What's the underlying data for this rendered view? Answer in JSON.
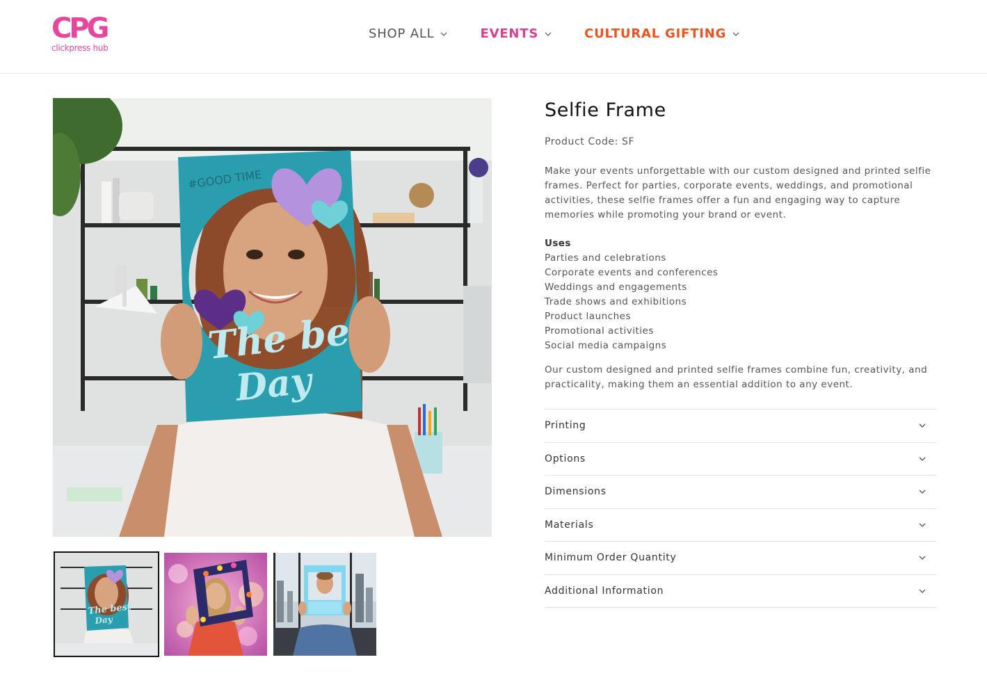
{
  "header": {
    "logo": {
      "mark": "CPG",
      "subtitle": "clickpress hub",
      "color": "#e8469e"
    },
    "nav": [
      {
        "label": "SHOP ALL",
        "color": "#555555",
        "icon": "chevron-down-icon"
      },
      {
        "label": "EVENTS",
        "color": "#e03c97",
        "icon": "chevron-down-icon"
      },
      {
        "label": "CULTURAL GIFTING",
        "color": "#f0521e",
        "icon": "chevron-down-icon"
      }
    ]
  },
  "gallery": {
    "main_image": {
      "frame_tag": "#GOOD TIME",
      "frame_text_line1": "The best",
      "frame_text_line2": "Day",
      "frame_color": "#2a9eaf"
    },
    "thumbnails": [
      {
        "selected": true,
        "frame_text_line1": "The best",
        "frame_text_line2": "Day"
      },
      {
        "selected": false
      },
      {
        "selected": false
      }
    ]
  },
  "product": {
    "title": "Selfie Frame",
    "code": "Product Code: SF",
    "description": "Make your events unforgettable with our custom designed and printed selfie frames. Perfect for parties, corporate events, weddings, and promotional activities, these selfie frames offer a fun and engaging way to capture memories while promoting your brand or event.",
    "uses_title": "Uses",
    "uses": [
      "Parties and celebrations",
      "Corporate events and conferences",
      "Weddings and engagements",
      "Trade shows and exhibitions",
      "Product launches",
      "Promotional activities",
      "Social media campaigns"
    ],
    "closing": "Our custom designed and printed selfie frames combine fun, creativity, and practicality, making them an essential addition to any event.",
    "accordion": [
      {
        "label": "Printing",
        "icon": "chevron-down-icon"
      },
      {
        "label": "Options",
        "icon": "chevron-down-icon"
      },
      {
        "label": "Dimensions",
        "icon": "chevron-down-icon"
      },
      {
        "label": "Materials",
        "icon": "chevron-down-icon"
      },
      {
        "label": "Minimum Order Quantity",
        "icon": "chevron-down-icon"
      },
      {
        "label": "Additional Information",
        "icon": "chevron-down-icon"
      }
    ]
  }
}
